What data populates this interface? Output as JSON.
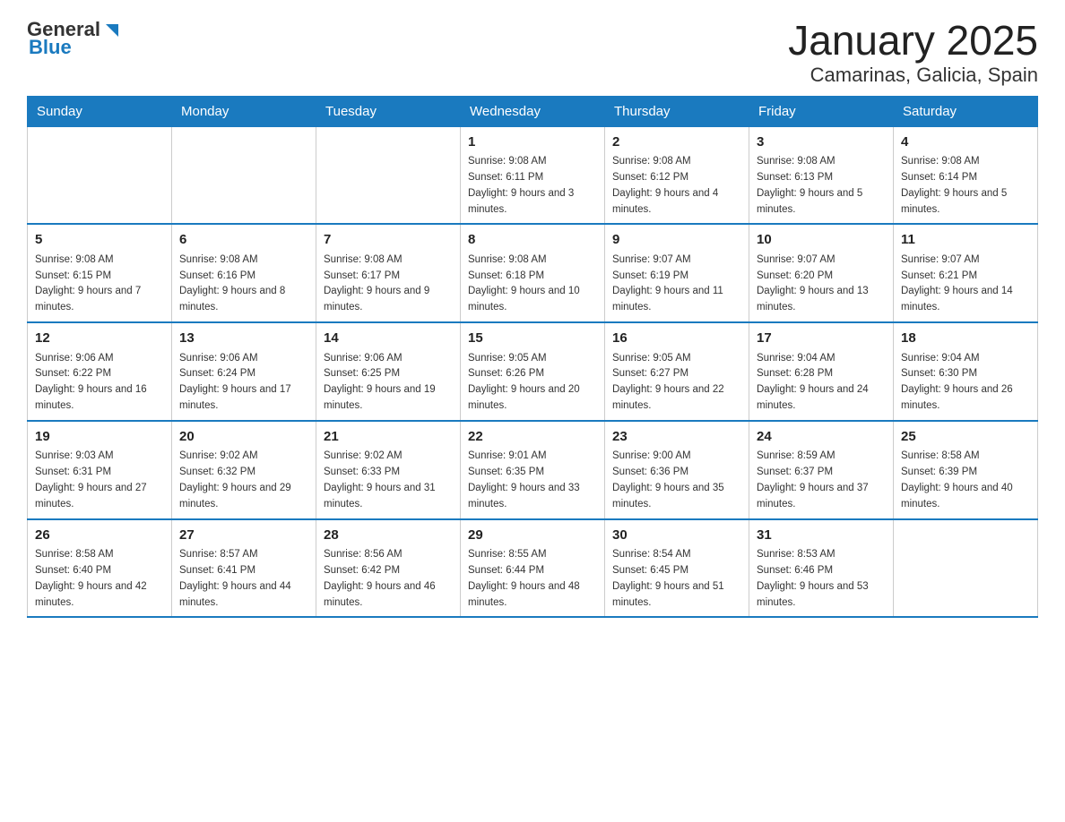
{
  "logo": {
    "general": "General",
    "blue": "Blue"
  },
  "title": "January 2025",
  "location": "Camarinas, Galicia, Spain",
  "days_of_week": [
    "Sunday",
    "Monday",
    "Tuesday",
    "Wednesday",
    "Thursday",
    "Friday",
    "Saturday"
  ],
  "weeks": [
    [
      {
        "day": "",
        "info": ""
      },
      {
        "day": "",
        "info": ""
      },
      {
        "day": "",
        "info": ""
      },
      {
        "day": "1",
        "info": "Sunrise: 9:08 AM\nSunset: 6:11 PM\nDaylight: 9 hours and 3 minutes."
      },
      {
        "day": "2",
        "info": "Sunrise: 9:08 AM\nSunset: 6:12 PM\nDaylight: 9 hours and 4 minutes."
      },
      {
        "day": "3",
        "info": "Sunrise: 9:08 AM\nSunset: 6:13 PM\nDaylight: 9 hours and 5 minutes."
      },
      {
        "day": "4",
        "info": "Sunrise: 9:08 AM\nSunset: 6:14 PM\nDaylight: 9 hours and 5 minutes."
      }
    ],
    [
      {
        "day": "5",
        "info": "Sunrise: 9:08 AM\nSunset: 6:15 PM\nDaylight: 9 hours and 7 minutes."
      },
      {
        "day": "6",
        "info": "Sunrise: 9:08 AM\nSunset: 6:16 PM\nDaylight: 9 hours and 8 minutes."
      },
      {
        "day": "7",
        "info": "Sunrise: 9:08 AM\nSunset: 6:17 PM\nDaylight: 9 hours and 9 minutes."
      },
      {
        "day": "8",
        "info": "Sunrise: 9:08 AM\nSunset: 6:18 PM\nDaylight: 9 hours and 10 minutes."
      },
      {
        "day": "9",
        "info": "Sunrise: 9:07 AM\nSunset: 6:19 PM\nDaylight: 9 hours and 11 minutes."
      },
      {
        "day": "10",
        "info": "Sunrise: 9:07 AM\nSunset: 6:20 PM\nDaylight: 9 hours and 13 minutes."
      },
      {
        "day": "11",
        "info": "Sunrise: 9:07 AM\nSunset: 6:21 PM\nDaylight: 9 hours and 14 minutes."
      }
    ],
    [
      {
        "day": "12",
        "info": "Sunrise: 9:06 AM\nSunset: 6:22 PM\nDaylight: 9 hours and 16 minutes."
      },
      {
        "day": "13",
        "info": "Sunrise: 9:06 AM\nSunset: 6:24 PM\nDaylight: 9 hours and 17 minutes."
      },
      {
        "day": "14",
        "info": "Sunrise: 9:06 AM\nSunset: 6:25 PM\nDaylight: 9 hours and 19 minutes."
      },
      {
        "day": "15",
        "info": "Sunrise: 9:05 AM\nSunset: 6:26 PM\nDaylight: 9 hours and 20 minutes."
      },
      {
        "day": "16",
        "info": "Sunrise: 9:05 AM\nSunset: 6:27 PM\nDaylight: 9 hours and 22 minutes."
      },
      {
        "day": "17",
        "info": "Sunrise: 9:04 AM\nSunset: 6:28 PM\nDaylight: 9 hours and 24 minutes."
      },
      {
        "day": "18",
        "info": "Sunrise: 9:04 AM\nSunset: 6:30 PM\nDaylight: 9 hours and 26 minutes."
      }
    ],
    [
      {
        "day": "19",
        "info": "Sunrise: 9:03 AM\nSunset: 6:31 PM\nDaylight: 9 hours and 27 minutes."
      },
      {
        "day": "20",
        "info": "Sunrise: 9:02 AM\nSunset: 6:32 PM\nDaylight: 9 hours and 29 minutes."
      },
      {
        "day": "21",
        "info": "Sunrise: 9:02 AM\nSunset: 6:33 PM\nDaylight: 9 hours and 31 minutes."
      },
      {
        "day": "22",
        "info": "Sunrise: 9:01 AM\nSunset: 6:35 PM\nDaylight: 9 hours and 33 minutes."
      },
      {
        "day": "23",
        "info": "Sunrise: 9:00 AM\nSunset: 6:36 PM\nDaylight: 9 hours and 35 minutes."
      },
      {
        "day": "24",
        "info": "Sunrise: 8:59 AM\nSunset: 6:37 PM\nDaylight: 9 hours and 37 minutes."
      },
      {
        "day": "25",
        "info": "Sunrise: 8:58 AM\nSunset: 6:39 PM\nDaylight: 9 hours and 40 minutes."
      }
    ],
    [
      {
        "day": "26",
        "info": "Sunrise: 8:58 AM\nSunset: 6:40 PM\nDaylight: 9 hours and 42 minutes."
      },
      {
        "day": "27",
        "info": "Sunrise: 8:57 AM\nSunset: 6:41 PM\nDaylight: 9 hours and 44 minutes."
      },
      {
        "day": "28",
        "info": "Sunrise: 8:56 AM\nSunset: 6:42 PM\nDaylight: 9 hours and 46 minutes."
      },
      {
        "day": "29",
        "info": "Sunrise: 8:55 AM\nSunset: 6:44 PM\nDaylight: 9 hours and 48 minutes."
      },
      {
        "day": "30",
        "info": "Sunrise: 8:54 AM\nSunset: 6:45 PM\nDaylight: 9 hours and 51 minutes."
      },
      {
        "day": "31",
        "info": "Sunrise: 8:53 AM\nSunset: 6:46 PM\nDaylight: 9 hours and 53 minutes."
      },
      {
        "day": "",
        "info": ""
      }
    ]
  ]
}
